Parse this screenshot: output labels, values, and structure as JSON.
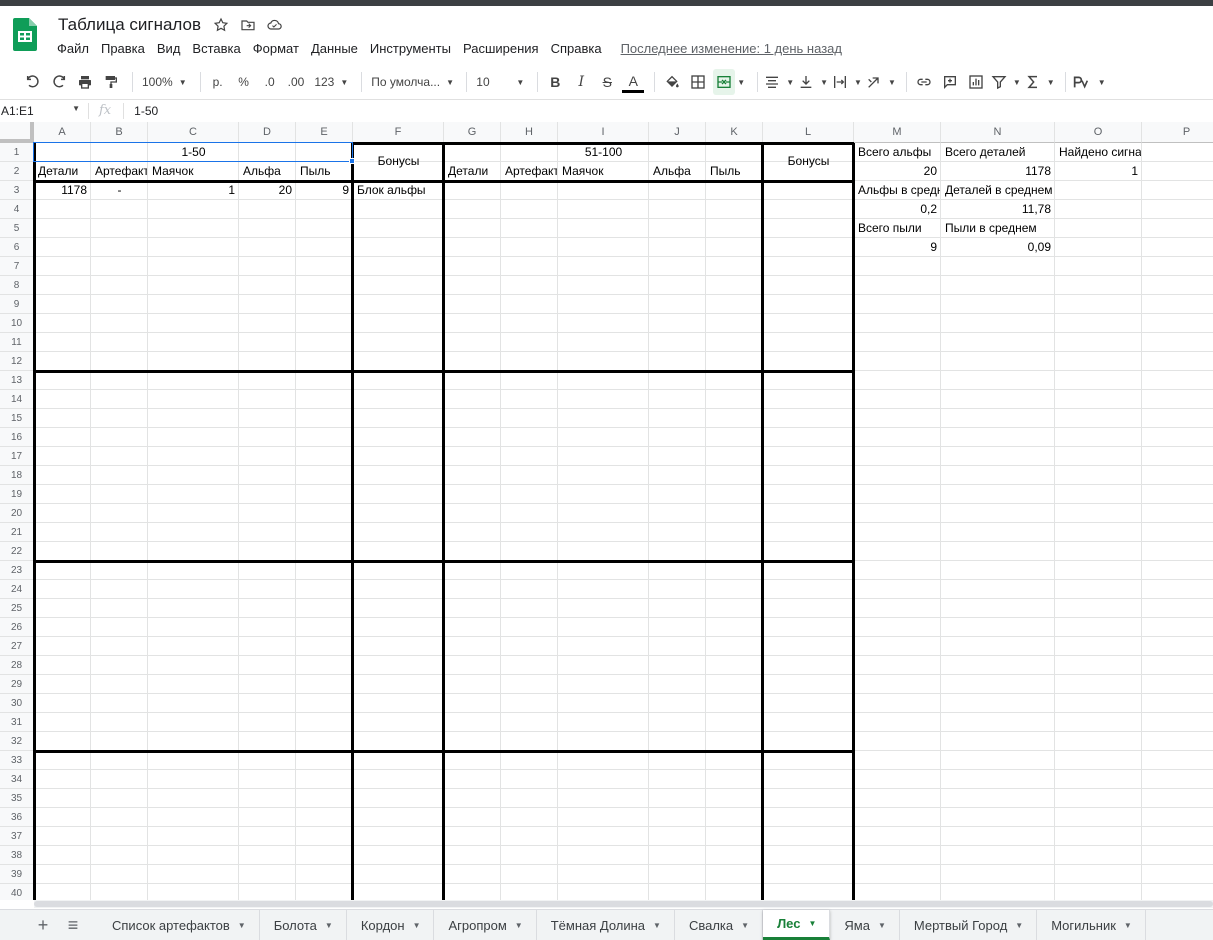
{
  "app": {
    "title": "Таблица сигналов",
    "accent_color": "#188038",
    "selection_color": "#1a73e8"
  },
  "menu": {
    "items": [
      "Файл",
      "Правка",
      "Вид",
      "Вставка",
      "Формат",
      "Данные",
      "Инструменты",
      "Расширения",
      "Справка"
    ],
    "last_edit": "Последнее изменение: 1 день назад"
  },
  "toolbar": {
    "zoom": "100%",
    "currency": "р.",
    "percent": "%",
    "decrease_decimals": ".0",
    "increase_decimals": ".00",
    "number_format": "123",
    "font": "По умолча...",
    "font_size": "10",
    "bold": "B",
    "italic": "I",
    "strike": "S",
    "text_color": "A"
  },
  "formula_bar": {
    "name_box": "A1:E1",
    "fx": "fx",
    "value": "1-50"
  },
  "columns": [
    "A",
    "B",
    "C",
    "D",
    "E",
    "F",
    "G",
    "H",
    "I",
    "J",
    "K",
    "L",
    "M",
    "N",
    "O",
    "P"
  ],
  "rows": [
    "1",
    "2",
    "3",
    "4",
    "5",
    "6",
    "7",
    "8",
    "9",
    "10",
    "11",
    "12",
    "13",
    "14",
    "15",
    "16",
    "17",
    "18",
    "19",
    "20",
    "21",
    "22",
    "23",
    "24",
    "25",
    "26",
    "27",
    "28",
    "29",
    "30",
    "31",
    "32",
    "33",
    "34",
    "35",
    "36",
    "37",
    "38",
    "39",
    "40"
  ],
  "cells": {
    "A1": "1-50",
    "F1": "Бонусы",
    "G1": "51-100",
    "L1": "Бонусы",
    "A2": "Детали",
    "B2": "Артефакт",
    "C2": "Маячок",
    "D2": "Альфа",
    "E2": "Пыль",
    "G2": "Детали",
    "H2": "Артефакт",
    "I2": "Маячок",
    "J2": "Альфа",
    "K2": "Пыль",
    "A3": "1178",
    "B3": "-",
    "C3": "1",
    "D3": "20",
    "E3": "9",
    "F3": "Блок альфы",
    "M1": "Всего альфы",
    "N1": "Всего деталей",
    "O1": "Найдено сигналов",
    "M2": "20",
    "N2": "1178",
    "O2": "1",
    "M3": "Альфы в среднем",
    "N3": "Деталей в среднем",
    "M4": "0,2",
    "N4": "11,78",
    "M5": "Всего пыли",
    "N5": "Пыли в среднем",
    "M6": "9",
    "N6": "0,09"
  },
  "sheets": {
    "tabs": [
      "Список артефактов",
      "Болота",
      "Кордон",
      "Агропром",
      "Тёмная Долина",
      "Свалка",
      "Лес",
      "Яма",
      "Мертвый Город",
      "Могильник"
    ],
    "active": "Лес"
  }
}
